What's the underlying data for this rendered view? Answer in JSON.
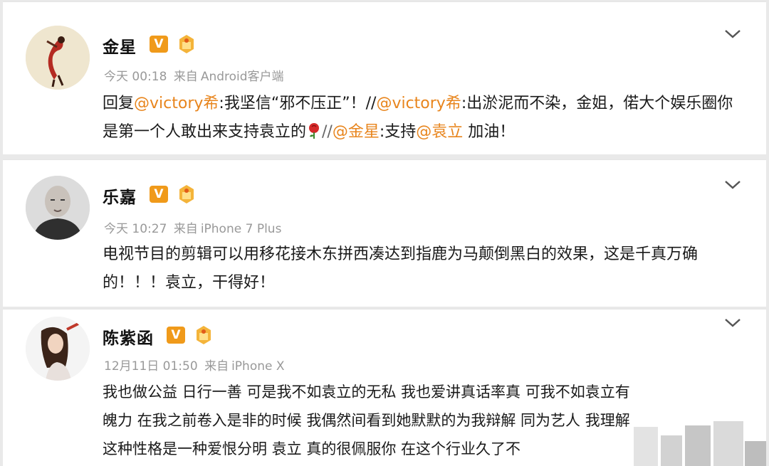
{
  "posts": [
    {
      "username": "金星",
      "v_badge": "V",
      "timestamp": "今天 00:18",
      "source_prefix": "来自",
      "source": "Android客户端",
      "text": {
        "p1": "回复",
        "m1": "@victory希",
        "p2": ":我坚信“邪不压正”！//",
        "m2": "@victory希",
        "p3": ":出淤泥而不染，金姐，偌大个娱乐圈你是第一个人敢出来支持袁立的",
        "p4": "//",
        "m3": "@金星",
        "p5": ":支持",
        "m4": "@袁立",
        "p6": " 加油！"
      },
      "avatar_icon": "dancer-avatar",
      "accent": "#e8851d"
    },
    {
      "username": "乐嘉",
      "v_badge": "V",
      "timestamp": "今天 10:27",
      "source_prefix": "来自",
      "source": "iPhone 7 Plus",
      "text": "电视节目的剪辑可以用移花接木东拼西凑达到指鹿为马颠倒黑白的效果，这是千真万确的！！！袁立，干得好！",
      "avatar_icon": "bald-man-avatar"
    },
    {
      "username": "陈紫函",
      "v_badge": "V",
      "timestamp": "12月11日 01:50",
      "source_prefix": "来自",
      "source": "iPhone X",
      "text_lines": [
        "我也做公益 日行一善 可是我不如袁立的无私 我也爱讲真话率真 可我不如袁立有",
        "魄力 在我之前卷入是非的时候 我偶然间看到她默默的为我辩解 同为艺人 我理解",
        "这种性格是一种爱恨分明  袁立 真的很佩服你 在这个行业久了不"
      ],
      "avatar_icon": "woman-avatar"
    }
  ],
  "colors": {
    "v_badge": "#f09a1a",
    "mention": "#e8851d",
    "meta": "#999999"
  }
}
